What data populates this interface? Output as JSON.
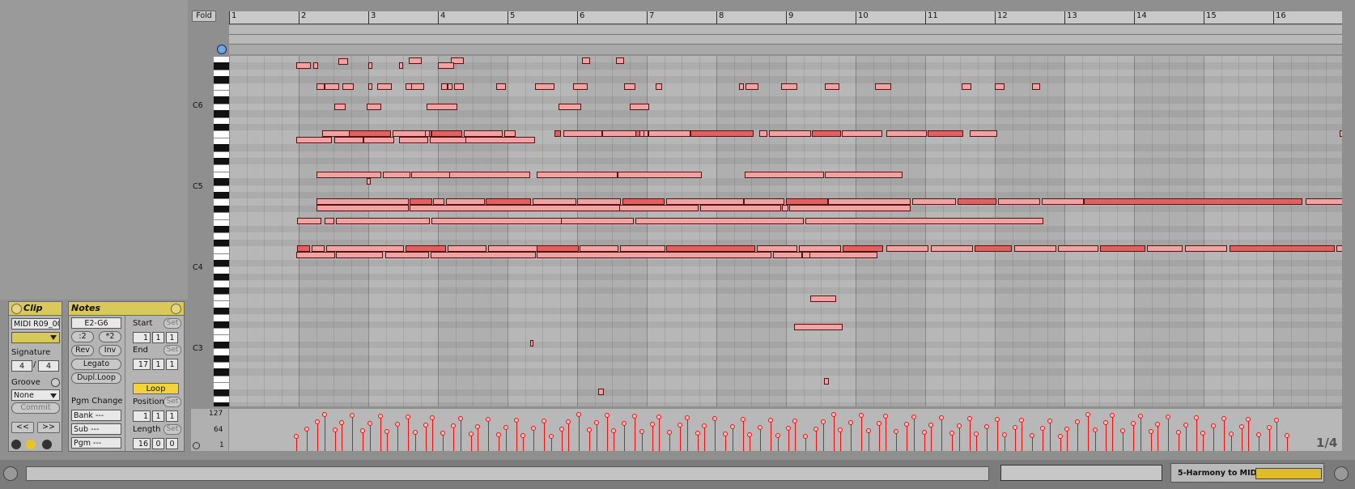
{
  "clip": {
    "title": "Clip",
    "name": "MIDI R09_00",
    "signature_label": "Signature",
    "sig_num": "4",
    "sig_den": "4",
    "groove_label": "Groove",
    "groove_value": "None",
    "commit": "Commit",
    "nav_prev": "<<",
    "nav_next": ">>"
  },
  "notes": {
    "title": "Notes",
    "range": "E2-G6",
    "half": ":2",
    "double": "*2",
    "rev": "Rev",
    "inv": "Inv",
    "legato": "Legato",
    "dupl": "Dupl.Loop",
    "start_label": "Start",
    "start": [
      "1",
      "1",
      "1"
    ],
    "end_label": "End",
    "end": [
      "17",
      "1",
      "1"
    ],
    "set": "Set",
    "loop": "Loop",
    "position_label": "Position",
    "position": [
      "1",
      "1",
      "1"
    ],
    "length_label": "Length",
    "length": [
      "16",
      "0",
      "0"
    ],
    "pgm_change": "Pgm Change",
    "bank": "Bank ---",
    "sub": "Sub ---",
    "pgm": "Pgm ---"
  },
  "editor": {
    "fold": "Fold",
    "bars": [
      "1",
      "2",
      "3",
      "4",
      "5",
      "6",
      "7",
      "8",
      "9",
      "10",
      "11",
      "12",
      "13",
      "14",
      "15",
      "16"
    ],
    "pitch_labels": [
      "C6",
      "C5",
      "C4",
      "C3"
    ],
    "velo_labels": [
      "127",
      "64",
      "1"
    ],
    "grid_fraction": "1/4"
  },
  "bottom": {
    "device": "5-Harmony to MIDI"
  },
  "colors": {
    "note_fill": "#f0a3a3",
    "velocity": "#e11",
    "accent": "#d9c85a"
  }
}
